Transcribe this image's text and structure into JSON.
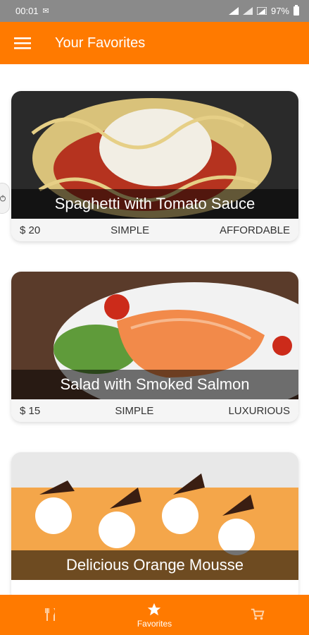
{
  "status_bar": {
    "time": "00:01",
    "battery": "97%"
  },
  "app_bar": {
    "title": "Your Favorites"
  },
  "meals": [
    {
      "title": "Spaghetti with Tomato Sauce",
      "price": "$ 20",
      "complexity": "SIMPLE",
      "affordability": "AFFORDABLE"
    },
    {
      "title": "Salad with Smoked Salmon",
      "price": "$ 15",
      "complexity": "SIMPLE",
      "affordability": "LUXURIOUS"
    },
    {
      "title": "Delicious Orange Mousse",
      "price": "",
      "complexity": "",
      "affordability": ""
    }
  ],
  "bottom_nav": {
    "items": [
      {
        "label": "",
        "icon": "cutlery-icon",
        "active": false
      },
      {
        "label": "Favorites",
        "icon": "star-icon",
        "active": true
      },
      {
        "label": "",
        "icon": "cart-icon",
        "active": false
      }
    ]
  },
  "colors": {
    "primary": "#ff7a00",
    "status_bar": "#8a8a8a"
  }
}
